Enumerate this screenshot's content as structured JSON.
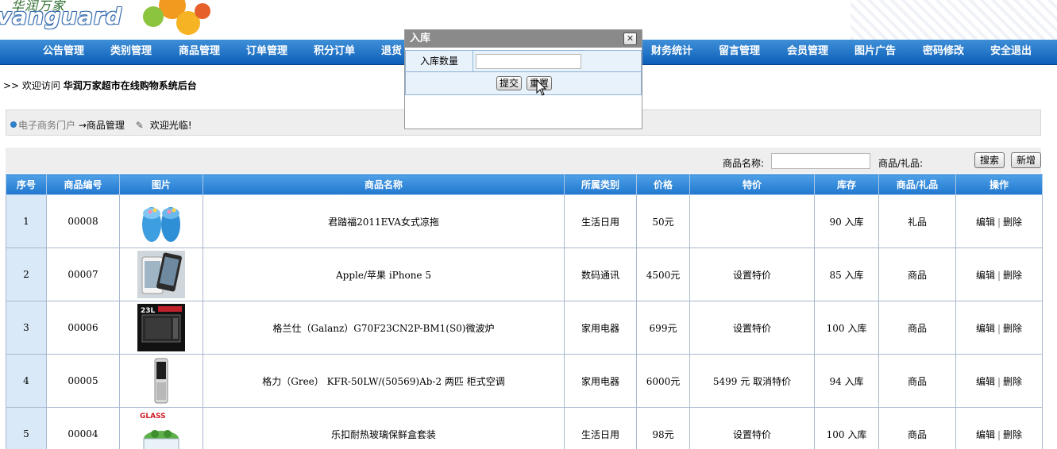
{
  "header": {
    "logo_cn": "华润万家",
    "logo_en": "vanguard"
  },
  "nav": {
    "items": [
      "公告管理",
      "类别管理",
      "商品管理",
      "订单管理",
      "积分订单",
      "退货",
      "财务统计",
      "留言管理",
      "会员管理",
      "图片广告",
      "密码修改",
      "安全退出"
    ]
  },
  "welcome": {
    "prefix": ">> 欢迎访问",
    "system": "华润万家超市在线购物系统后台"
  },
  "breadcrumb": {
    "portal": "电子商务门户",
    "section": "→商品管理",
    "greeting": "欢迎光临!"
  },
  "search": {
    "name_label": "商品名称:",
    "name_value": "",
    "type_label": "商品/礼品:",
    "search_button": "搜索",
    "add_button": "新增"
  },
  "table": {
    "columns": [
      "序号",
      "商品编号",
      "图片",
      "商品名称",
      "所属类别",
      "价格",
      "特价",
      "库存",
      "商品/礼品",
      "操作"
    ],
    "edit_label": "编辑",
    "delete_label": "删除",
    "stock_action": "入库",
    "rows": [
      {
        "idx": "1",
        "code": "00008",
        "name": "君踏福2011EVA女式凉拖",
        "category": "生活日用",
        "price": "50元",
        "special": "",
        "stock": "90",
        "kind": "礼品",
        "image": "slipper"
      },
      {
        "idx": "2",
        "code": "00007",
        "name": "Apple/苹果  iPhone 5",
        "category": "数码通讯",
        "price": "4500元",
        "special": "设置特价",
        "stock": "85",
        "kind": "商品",
        "image": "iphone"
      },
      {
        "idx": "3",
        "code": "00006",
        "name": "格兰仕（Galanz）G70F23CN2P-BM1(S0)微波炉",
        "category": "家用电器",
        "price": "699元",
        "special": "设置特价",
        "stock": "100",
        "kind": "商品",
        "image": "microwave"
      },
      {
        "idx": "4",
        "code": "00005",
        "name": "格力（Gree）  KFR-50LW/(50569)Ab-2 两匹  柜式空调",
        "category": "家用电器",
        "price": "6000元",
        "special": "5499 元  取消特价",
        "stock": "94",
        "kind": "商品",
        "image": "aircon"
      },
      {
        "idx": "5",
        "code": "00004",
        "name": "乐扣耐热玻璃保鲜盒套装",
        "category": "生活日用",
        "price": "98元",
        "special": "设置特价",
        "stock": "100",
        "kind": "商品",
        "image": "glass"
      }
    ]
  },
  "modal": {
    "title": "入库",
    "close_symbol": "✕",
    "field_label": "入库数量",
    "field_value": "",
    "submit_label": "提交",
    "reset_label": "重置"
  },
  "images": {
    "glass_text": "GLASS",
    "microwave_text": "23L"
  },
  "colors": {
    "nav_top": "#3f8fd8",
    "nav_bottom": "#0c5fb8",
    "table_header": "#1f77cf",
    "index_cell": "#d9e9f7",
    "modal_title": "#8a8a8a"
  }
}
